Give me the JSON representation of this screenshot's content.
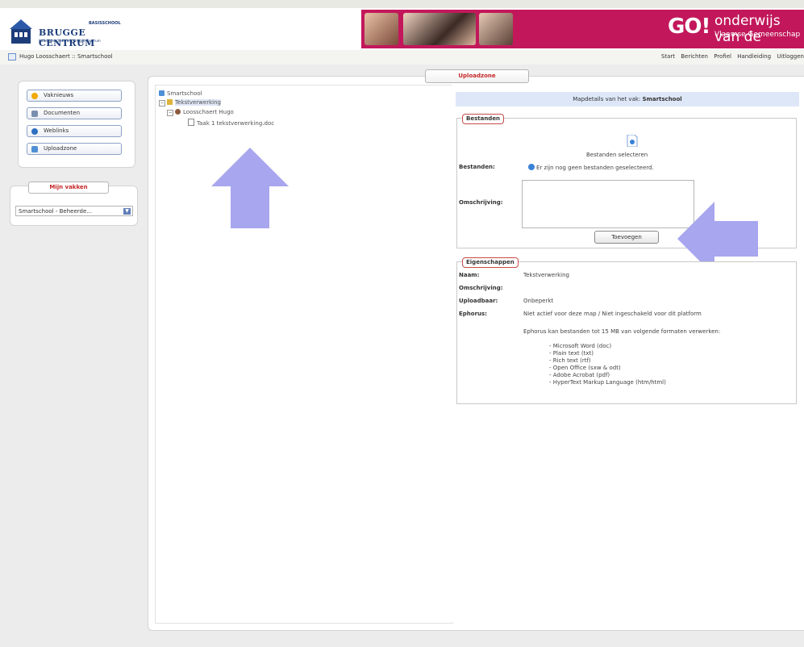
{
  "header": {
    "logo": {
      "main": "BRUGGE CENTRUM",
      "top": "BASISSCHOOL",
      "sub": "Katholieke Onderwijs Brugge-Centrum"
    },
    "go_logo": "GO!",
    "go_text1": "onderwijs van de",
    "go_text2": "Vlaamse Gemeenschap"
  },
  "toolbar": {
    "breadcrumb": "Hugo Loosschaert :: Smartschool",
    "nav": [
      "Start",
      "Berichten",
      "Profiel",
      "Handleiding",
      "Uitloggen"
    ]
  },
  "sidebar": {
    "items": [
      {
        "label": "Vaknieuws",
        "icon": "sun-icon",
        "color": "#f2a900"
      },
      {
        "label": "Documenten",
        "icon": "documents-icon",
        "color": "#7a8fb0"
      },
      {
        "label": "Weblinks",
        "icon": "globe-icon",
        "color": "#2f6fc2"
      },
      {
        "label": "Uploadzone",
        "icon": "upload-icon",
        "color": "#4f8fd6"
      }
    ],
    "vakken_title": "Mijn vakken",
    "vakken_selected": "Smartschool - Beheerde..."
  },
  "tab": {
    "label": "Uploadzone"
  },
  "tree": {
    "root": "Smartschool",
    "folder": "Tekstverwerking",
    "user": "Loosschaert Hugo",
    "file": "Taak 1 tekstverwerking.doc"
  },
  "details": {
    "header_prefix": "Mapdetails van het vak:",
    "header_vak": "Smartschool",
    "bestanden": {
      "legend": "Bestanden",
      "select_label": "Bestanden selecteren",
      "files_label": "Bestanden:",
      "files_value": "Er zijn nog geen bestanden geselecteerd.",
      "desc_label": "Omschrijving:",
      "add_button": "Toevoegen"
    },
    "eigenschappen": {
      "legend": "Eigenschappen",
      "naam_label": "Naam:",
      "naam_value": "Tekstverwerking",
      "omschrijving_label": "Omschrijving:",
      "uploadbaar_label": "Uploadbaar:",
      "uploadbaar_value": "Onbeperkt",
      "ephorus_label": "Ephorus:",
      "ephorus_value": "Niet actief voor deze map / Niet ingeschakeld voor dit platform",
      "ephorus_note": "Ephorus kan bestanden tot 15 MB van volgende formaten verwerken:",
      "formats": [
        "- Microsoft Word (doc)",
        "- Plain text (txt)",
        "- Rich text (rtf)",
        "- Open Office (sxw & odt)",
        "- Adobe Acrobat (pdf)",
        "- HyperText Markup Language (htm/html)"
      ]
    }
  }
}
